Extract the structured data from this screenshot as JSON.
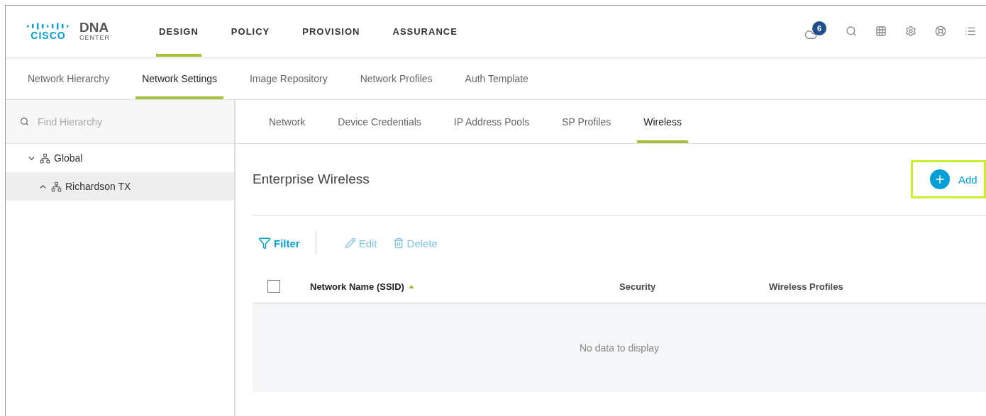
{
  "brand": {
    "logo_text": "CISCO",
    "product": "DNA",
    "product_sub": "CENTER"
  },
  "main_nav": [
    {
      "label": "DESIGN",
      "selected": true
    },
    {
      "label": "POLICY",
      "selected": false
    },
    {
      "label": "PROVISION",
      "selected": false
    },
    {
      "label": "ASSURANCE",
      "selected": false
    }
  ],
  "notifications": {
    "count": "6"
  },
  "sub_nav": [
    {
      "label": "Network Hierarchy",
      "selected": false
    },
    {
      "label": "Network Settings",
      "selected": true
    },
    {
      "label": "Image Repository",
      "selected": false
    },
    {
      "label": "Network Profiles",
      "selected": false
    },
    {
      "label": "Auth Template",
      "selected": false
    }
  ],
  "sidebar": {
    "search": {
      "placeholder": "Find Hierarchy"
    },
    "tree": [
      {
        "label": "Global",
        "expanded": true,
        "selected": false,
        "children": [
          {
            "label": "Richardson TX",
            "expanded": false,
            "selected": true
          }
        ]
      }
    ]
  },
  "settings_tabs": [
    {
      "label": "Network",
      "selected": false
    },
    {
      "label": "Device Credentials",
      "selected": false
    },
    {
      "label": "IP Address Pools",
      "selected": false
    },
    {
      "label": "SP Profiles",
      "selected": false
    },
    {
      "label": "Wireless",
      "selected": true
    }
  ],
  "section": {
    "title": "Enterprise Wireless",
    "add_button": {
      "label": "Add",
      "highlighted": true
    }
  },
  "toolbar": [
    {
      "label": "Filter",
      "disabled": false,
      "kind": "filter"
    },
    {
      "label": "Edit",
      "disabled": true,
      "kind": "edit"
    },
    {
      "label": "Delete",
      "disabled": true,
      "kind": "delete"
    }
  ],
  "table": {
    "select_all_checked": false,
    "columns": [
      {
        "label": "Network Name (SSID)",
        "sorted": true
      },
      {
        "label": "Security",
        "sorted": false
      },
      {
        "label": "Wireless Profiles",
        "sorted": false
      }
    ],
    "empty_message": "No data to display"
  }
}
